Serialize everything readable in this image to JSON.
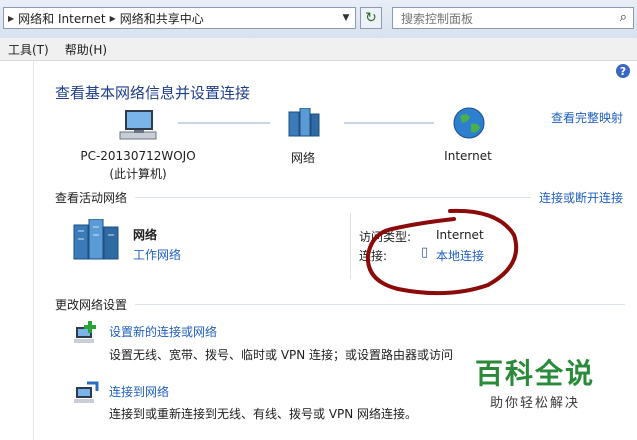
{
  "address_bar": {
    "crumbs": [
      "网络和 Internet",
      "网络和共享中心"
    ],
    "search_placeholder": "搜索控制面板"
  },
  "menu": {
    "items": [
      "工具(T)",
      "帮助(H)"
    ]
  },
  "page": {
    "title": "查看基本网络信息并设置连接",
    "full_map_link": "查看完整映射"
  },
  "map": {
    "computer_name": "PC-20130712WOJO",
    "computer_note": "(此计算机)",
    "network_label": "网络",
    "internet_label": "Internet"
  },
  "active_networks": {
    "header": "查看活动网络",
    "connect_link": "连接或断开连接",
    "network_name": "网络",
    "network_type": "工作网络",
    "access_type_label": "访问类型:",
    "access_type_value": "Internet",
    "connection_label": "连接:",
    "connection_value": "本地连接"
  },
  "change_settings": {
    "header": "更改网络设置",
    "tasks": [
      {
        "link": "设置新的连接或网络",
        "desc": "设置无线、宽带、拨号、临时或 VPN 连接；或设置路由器或访问"
      },
      {
        "link": "连接到网络",
        "desc": "连接到或重新连接到无线、有线、拨号或 VPN 网络连接。"
      }
    ]
  },
  "watermark": {
    "main": "百科全说",
    "sub": "助你轻松解决"
  },
  "colors": {
    "link": "#1f5fbf",
    "title": "#1e3e8b",
    "annotation": "#8b0a0a",
    "watermark": "#2a8a3a"
  }
}
